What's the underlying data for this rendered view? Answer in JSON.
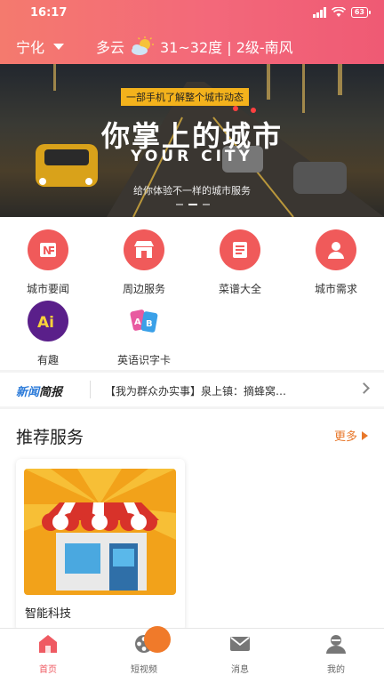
{
  "status_bar": {
    "time": "16:17",
    "battery": "63"
  },
  "header": {
    "location": "宁化",
    "weather_condition": "多云",
    "weather_detail": "31~32度 | 2级-南风"
  },
  "banner": {
    "tag": "一部手机了解整个城市动态",
    "title": "你掌上的城市",
    "subtitle": "YOUR CITY",
    "description": "给你体验不一样的城市服务"
  },
  "services": [
    {
      "label": "城市要闻",
      "icon": "news-icon",
      "color": "#f05a5a"
    },
    {
      "label": "周边服务",
      "icon": "store-icon",
      "color": "#f05a5a"
    },
    {
      "label": "菜谱大全",
      "icon": "recipe-book-icon",
      "color": "#f05a5a"
    },
    {
      "label": "城市需求",
      "icon": "person-icon",
      "color": "#f05a5a"
    },
    {
      "label": "有趣",
      "icon": "ai-icon",
      "color": "#5a1f8a"
    },
    {
      "label": "英语识字卡",
      "icon": "flashcards-icon",
      "color": "#e85aa0"
    }
  ],
  "news": {
    "brand_part1": "新闻",
    "brand_part2": "简报",
    "headline": "【我为群众办实事】泉上镇：摘蜂窝…"
  },
  "recommended": {
    "title": "推荐服务",
    "more": "更多",
    "cards": [
      {
        "label": "智能科技",
        "icon": "shop-awning-icon"
      }
    ]
  },
  "tabbar": [
    {
      "label": "首页",
      "icon": "home-icon",
      "active": true
    },
    {
      "label": "短视频",
      "icon": "film-reel-icon",
      "active": false
    },
    {
      "label": "消息",
      "icon": "mail-icon",
      "active": false
    },
    {
      "label": "我的",
      "icon": "user-icon",
      "active": false
    }
  ],
  "colors": {
    "accent": "#ef5a62",
    "header_start": "#f47a6e",
    "header_end": "#ef5a74",
    "more": "#e8772a"
  }
}
